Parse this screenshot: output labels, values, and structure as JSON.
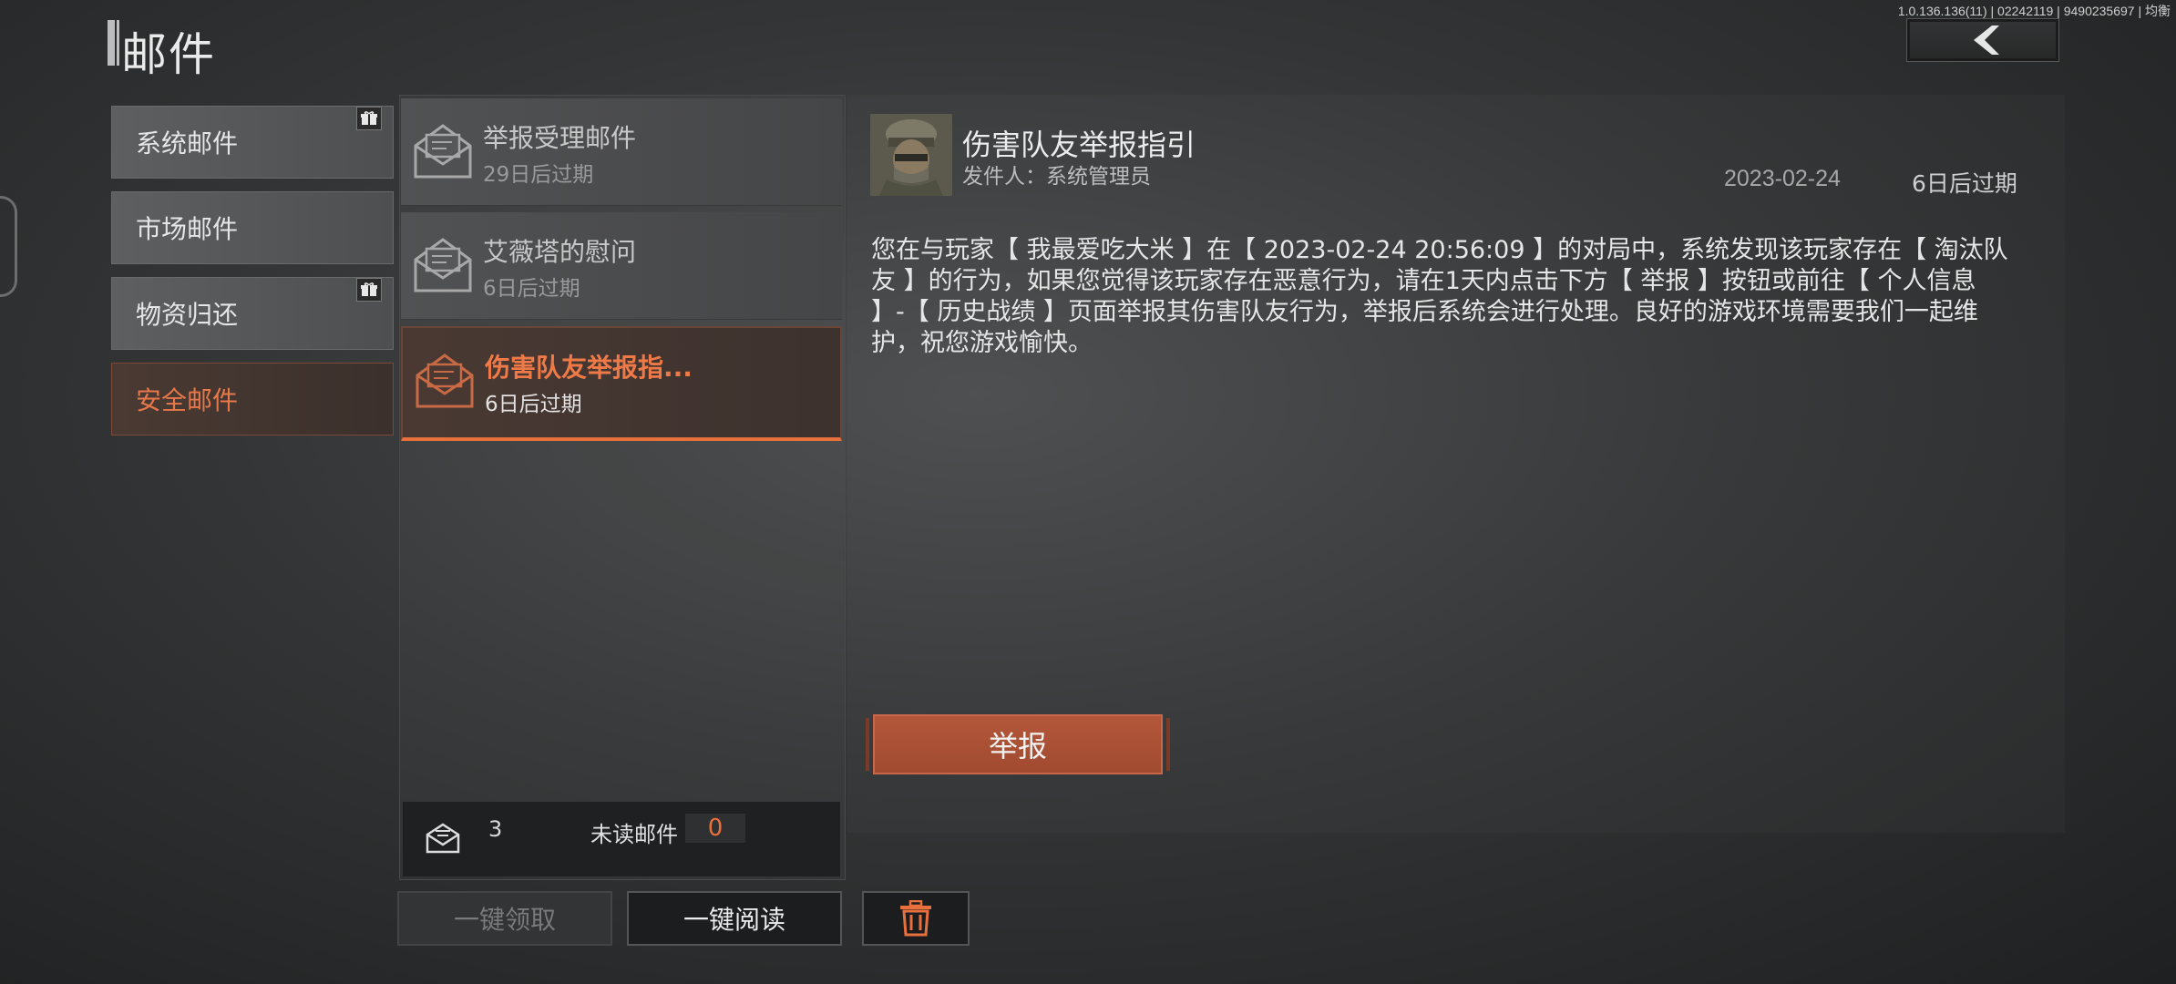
{
  "header": {
    "title": "邮件",
    "version": "1.0.136.136(11) | 02242119 | 9490235697 | 均衡"
  },
  "categories": [
    {
      "label": "系统邮件",
      "has_gift": true
    },
    {
      "label": "市场邮件",
      "has_gift": false
    },
    {
      "label": "物资归还",
      "has_gift": true
    },
    {
      "label": "安全邮件",
      "has_gift": false,
      "active": true
    }
  ],
  "mails": [
    {
      "title": "举报受理邮件",
      "expiry": "29日后过期"
    },
    {
      "title": "艾薇塔的慰问",
      "expiry": "6日后过期"
    },
    {
      "title": "伤害队友举报指...",
      "expiry": "6日后过期",
      "active": true
    }
  ],
  "stats": {
    "total": "3",
    "unread_label": "未读邮件",
    "unread_count": "0"
  },
  "actions": {
    "claim_all": "一键领取",
    "read_all": "一键阅读"
  },
  "detail": {
    "title": "伤害队友举报指引",
    "sender": "发件人：系统管理员",
    "date": "2023-02-24",
    "expiry": "6日后过期",
    "body": "您在与玩家【 我最爱吃大米 】在【 2023-02-24 20:56:09 】的对局中，系统发现该玩家存在【 淘汰队友 】的行为，如果您觉得该玩家存在恶意行为，请在1天内点击下方【 举报 】按钮或前往【 个人信息 】-【 历史战绩 】页面举报其伤害队友行为，举报后系统会进行处理。良好的游戏环境需要我们一起维护，祝您游戏愉快。",
    "report_button": "举报"
  },
  "colors": {
    "accent": "#e8703d",
    "report_button": "#a84e33"
  }
}
